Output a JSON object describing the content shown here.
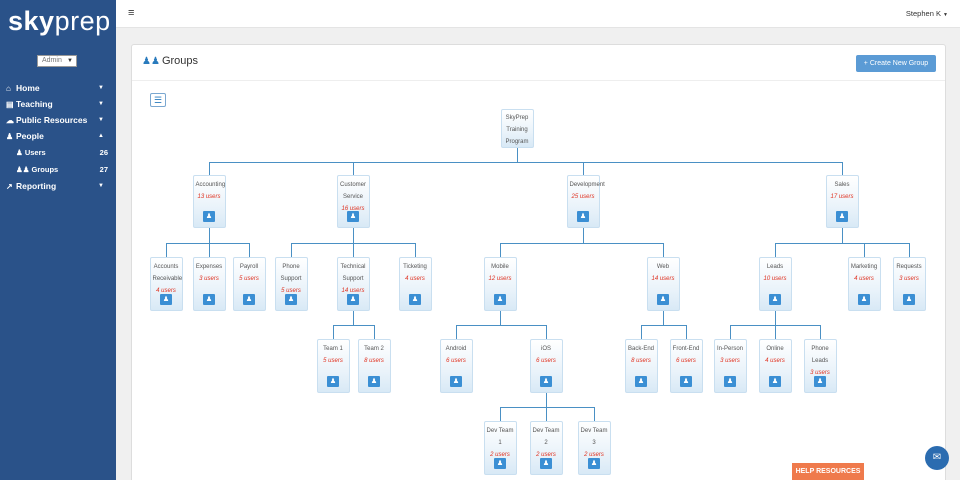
{
  "brand": {
    "logo_sky": "sky",
    "logo_prep": "prep"
  },
  "sidebar": {
    "role": "Admin",
    "items": [
      {
        "label": "Home",
        "icon": "home-icon",
        "glyph": "⌂",
        "caret": "▼"
      },
      {
        "label": "Teaching",
        "icon": "book-icon",
        "glyph": "▤",
        "caret": "▼"
      },
      {
        "label": "Public Resources",
        "icon": "cloud-icon",
        "glyph": "☁",
        "caret": "▼"
      },
      {
        "label": "People",
        "icon": "person-icon",
        "glyph": "♟",
        "caret": "▲"
      }
    ],
    "subitems": [
      {
        "label": "Users",
        "count": "26",
        "icon": "user-icon",
        "glyph": "♟"
      },
      {
        "label": "Groups",
        "count": "27",
        "icon": "users-icon",
        "glyph": "♟♟"
      }
    ],
    "reporting": {
      "label": "Reporting",
      "icon": "line-chart-icon",
      "glyph": "↗",
      "caret": "▼"
    }
  },
  "topbar": {
    "hamburger": "≡",
    "user": "Stephen K",
    "caret": "▼"
  },
  "panel": {
    "title": "Groups",
    "title_icon": "♟♟",
    "create_button": "+ Create New Group",
    "view_toggle": "☰"
  },
  "tree": {
    "label": "SkyPrep Training Program",
    "children": [
      {
        "label": "Accounting",
        "users": "13 users",
        "children": [
          {
            "label": "Accounts Receivable",
            "users": "4 users"
          },
          {
            "label": "Expenses",
            "users": "3 users"
          },
          {
            "label": "Payroll",
            "users": "5 users"
          }
        ]
      },
      {
        "label": "Customer Service",
        "users": "16 users",
        "children": [
          {
            "label": "Phone Support",
            "users": "5 users"
          },
          {
            "label": "Technical Support",
            "users": "14 users",
            "children": [
              {
                "label": "Team 1",
                "users": "5 users"
              },
              {
                "label": "Team 2",
                "users": "8 users"
              }
            ]
          },
          {
            "label": "Ticketing",
            "users": "4 users"
          }
        ]
      },
      {
        "label": "Development",
        "users": "25 users",
        "children": [
          {
            "label": "Mobile",
            "users": "12 users",
            "children": [
              {
                "label": "Android",
                "users": "6 users"
              },
              {
                "label": "iOS",
                "users": "6 users",
                "children": [
                  {
                    "label": "Dev Team 1",
                    "users": "2 users"
                  },
                  {
                    "label": "Dev Team 2",
                    "users": "2 users"
                  },
                  {
                    "label": "Dev Team 3",
                    "users": "2 users"
                  }
                ]
              }
            ]
          },
          {
            "label": "Web",
            "users": "14 users",
            "children": [
              {
                "label": "Back-End",
                "users": "8 users"
              },
              {
                "label": "Front-End",
                "users": "6 users"
              }
            ]
          }
        ]
      },
      {
        "label": "Sales",
        "users": "17 users",
        "children": [
          {
            "label": "Leads",
            "users": "10 users",
            "children": [
              {
                "label": "In-Person",
                "users": "3 users"
              },
              {
                "label": "Online",
                "users": "4 users"
              },
              {
                "label": "Phone Leads",
                "users": "3 users"
              }
            ]
          },
          {
            "label": "Marketing",
            "users": "4 users"
          },
          {
            "label": "Requests",
            "users": "3 users"
          }
        ]
      }
    ]
  },
  "help_button": "HELP RESOURCES",
  "chat_glyph": "✉"
}
